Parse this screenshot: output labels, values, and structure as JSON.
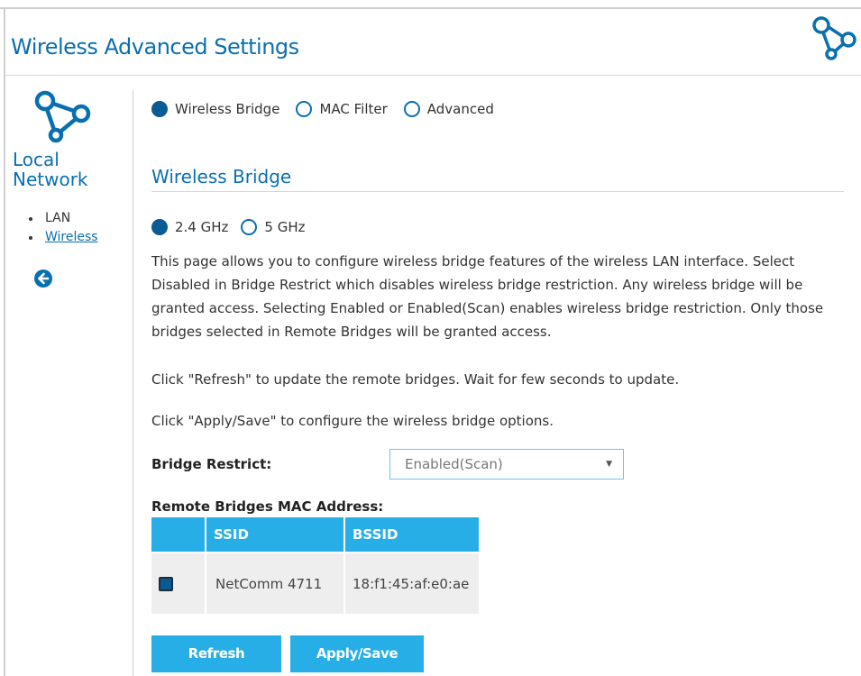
{
  "page": {
    "title": "Wireless Advanced Settings"
  },
  "sidebar": {
    "title_line1": "Local",
    "title_line2": "Network",
    "items": [
      {
        "label": "LAN",
        "active": false
      },
      {
        "label": "Wireless",
        "active": true
      }
    ],
    "back_icon": "arrow-left-circle-icon"
  },
  "tabs": [
    {
      "label": "Wireless Bridge",
      "selected": true
    },
    {
      "label": "MAC Filter",
      "selected": false
    },
    {
      "label": "Advanced",
      "selected": false
    }
  ],
  "section": {
    "title": "Wireless Bridge"
  },
  "bands": [
    {
      "label": "2.4 GHz",
      "selected": true
    },
    {
      "label": "5 GHz",
      "selected": false
    }
  ],
  "description": {
    "para1": "This page allows you to configure wireless bridge features of the wireless LAN interface. Select Disabled in Bridge Restrict which disables wireless bridge restriction. Any wireless bridge will be granted access. Selecting Enabled or Enabled(Scan) enables wireless bridge restriction. Only those bridges selected in Remote Bridges will be granted access.",
    "para2": "Click \"Refresh\" to update the remote bridges. Wait for few seconds to update.",
    "para3": "Click \"Apply/Save\" to configure the wireless bridge options."
  },
  "bridge_restrict": {
    "label": "Bridge Restrict:",
    "value": "Enabled(Scan)"
  },
  "remote_bridges": {
    "label": "Remote Bridges MAC Address:",
    "columns": [
      "",
      "SSID",
      "BSSID"
    ],
    "rows": [
      {
        "checked": true,
        "ssid": "NetComm 4711",
        "bssid": "18:f1:45:af:e0:ae"
      }
    ]
  },
  "buttons": {
    "refresh": "Refresh",
    "apply_save": "Apply/Save"
  },
  "colors": {
    "accent": "#0a6fb0",
    "header": "#27aee6",
    "radio_fill": "#0a5a96"
  }
}
